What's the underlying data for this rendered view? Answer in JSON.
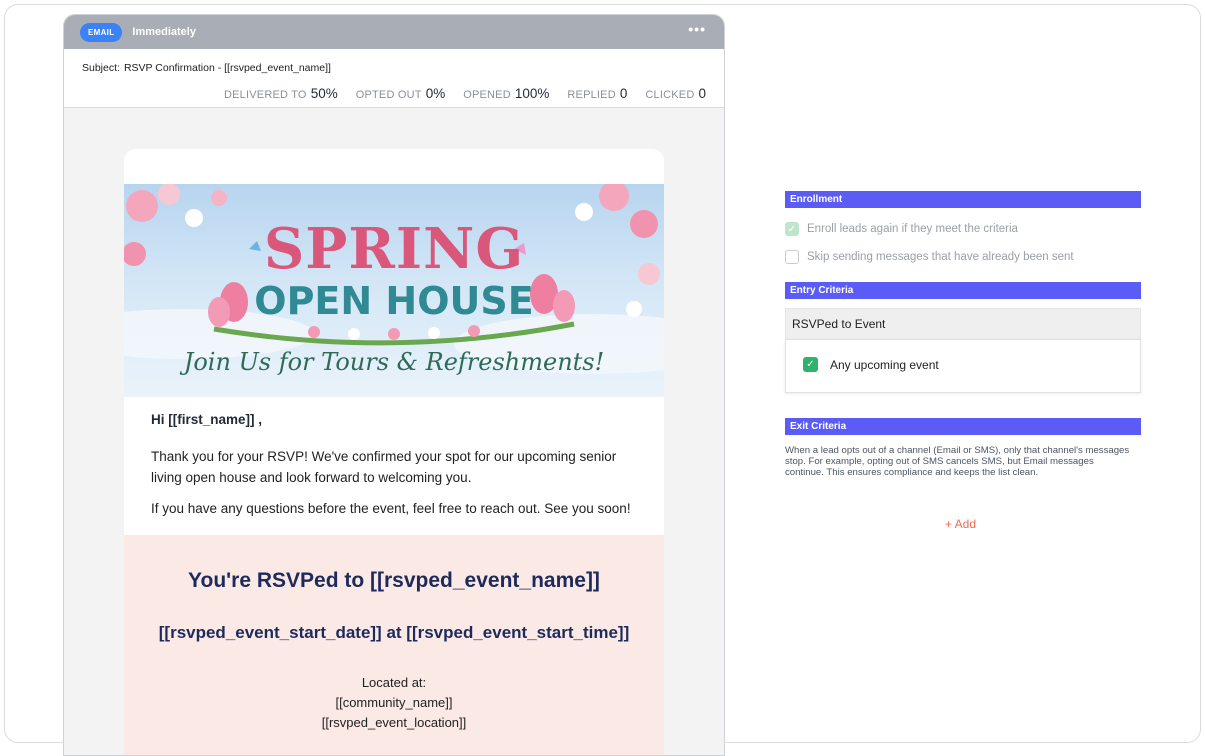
{
  "email": {
    "channel_badge": "EMAIL",
    "timing": "Immediately",
    "more_icon": "ellipsis-icon",
    "subject_label": "Subject:",
    "subject_value": "RSVP Confirmation - [[rsvped_event_name]]",
    "stats": [
      {
        "label": "DELIVERED TO",
        "value": "50%"
      },
      {
        "label": "OPTED OUT",
        "value": "0%"
      },
      {
        "label": "OPENED",
        "value": "100%"
      },
      {
        "label": "REPLIED",
        "value": "0"
      },
      {
        "label": "CLICKED",
        "value": "0"
      }
    ],
    "hero": {
      "title_line1": "SPRING",
      "title_line2": "OPEN HOUSE",
      "tagline": "Join Us for Tours & Refreshments!"
    },
    "greeting": "Hi [[first_name]] ,",
    "paragraph1": "Thank you for your RSVP! We've confirmed your spot for our upcoming senior living open house and look forward to welcoming you.",
    "paragraph2": "If you have any questions before the event, feel free to reach out. See you soon!",
    "rsvp": {
      "title": "You're RSVPed to  [[rsvped_event_name]]",
      "datetime": "[[rsvped_event_start_date]] at [[rsvped_event_start_time]]",
      "located_label": "Located at:",
      "community": "[[community_name]]",
      "location": "[[rsvped_event_location]]"
    }
  },
  "panel": {
    "enrollment": {
      "heading": "Enrollment",
      "options": [
        {
          "label": "Enroll leads again if they meet the criteria",
          "checked": true
        },
        {
          "label": "Skip sending messages that have already been sent",
          "checked": false
        }
      ]
    },
    "entry": {
      "heading": "Entry Criteria",
      "criteria_title": "RSVPed to Event",
      "criteria_option": {
        "label": "Any upcoming event",
        "checked": true
      }
    },
    "exit": {
      "heading": "Exit Criteria",
      "description": "When a lead opts out of a channel (Email or SMS), only that channel's messages stop. For example, opting out of SMS cancels SMS, but Email messages continue. This ensures compliance and keeps the list clean."
    },
    "add_button": "+ Add"
  },
  "colors": {
    "accent_bar": "#5b5cf6",
    "badge_blue": "#3b82f6",
    "check_green": "#2fb36c",
    "add_orange": "#f26b4f",
    "rsvp_bg": "#fae9e4"
  }
}
